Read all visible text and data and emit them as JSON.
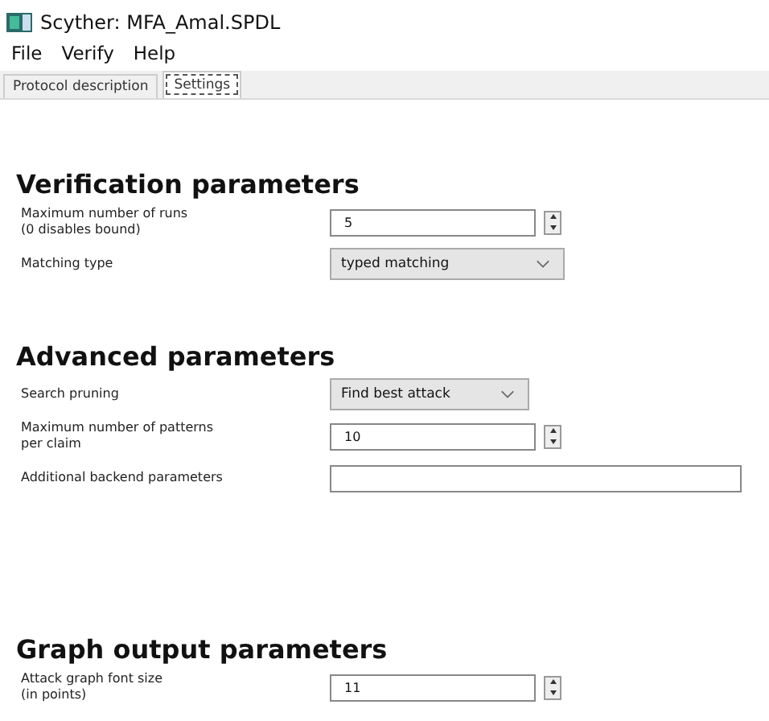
{
  "window": {
    "title": "Scyther: MFA_Amal.SPDL"
  },
  "menu": [
    "File",
    "Verify",
    "Help"
  ],
  "tabs": [
    {
      "label": "Protocol description",
      "selected": false
    },
    {
      "label": "Settings",
      "selected": true
    }
  ],
  "sections": [
    {
      "heading": "Verification parameters",
      "rows": [
        {
          "kind": "spin",
          "label": "Maximum number of runs\n(0 disables bound)",
          "value": "5"
        },
        {
          "kind": "combo",
          "label": "Matching type",
          "value": "typed matching"
        }
      ]
    },
    {
      "heading": "Advanced parameters",
      "rows": [
        {
          "kind": "combo",
          "label": "Search pruning",
          "value": "Find best attack"
        },
        {
          "kind": "spin",
          "label": "Maximum number of patterns\nper claim",
          "value": "10"
        },
        {
          "kind": "entry",
          "label": "Additional backend parameters"
        }
      ]
    },
    {
      "heading": "Graph output parameters",
      "rows": [
        {
          "kind": "spin",
          "label": "Attack graph font size\n(in points)",
          "value": "11"
        }
      ]
    }
  ]
}
